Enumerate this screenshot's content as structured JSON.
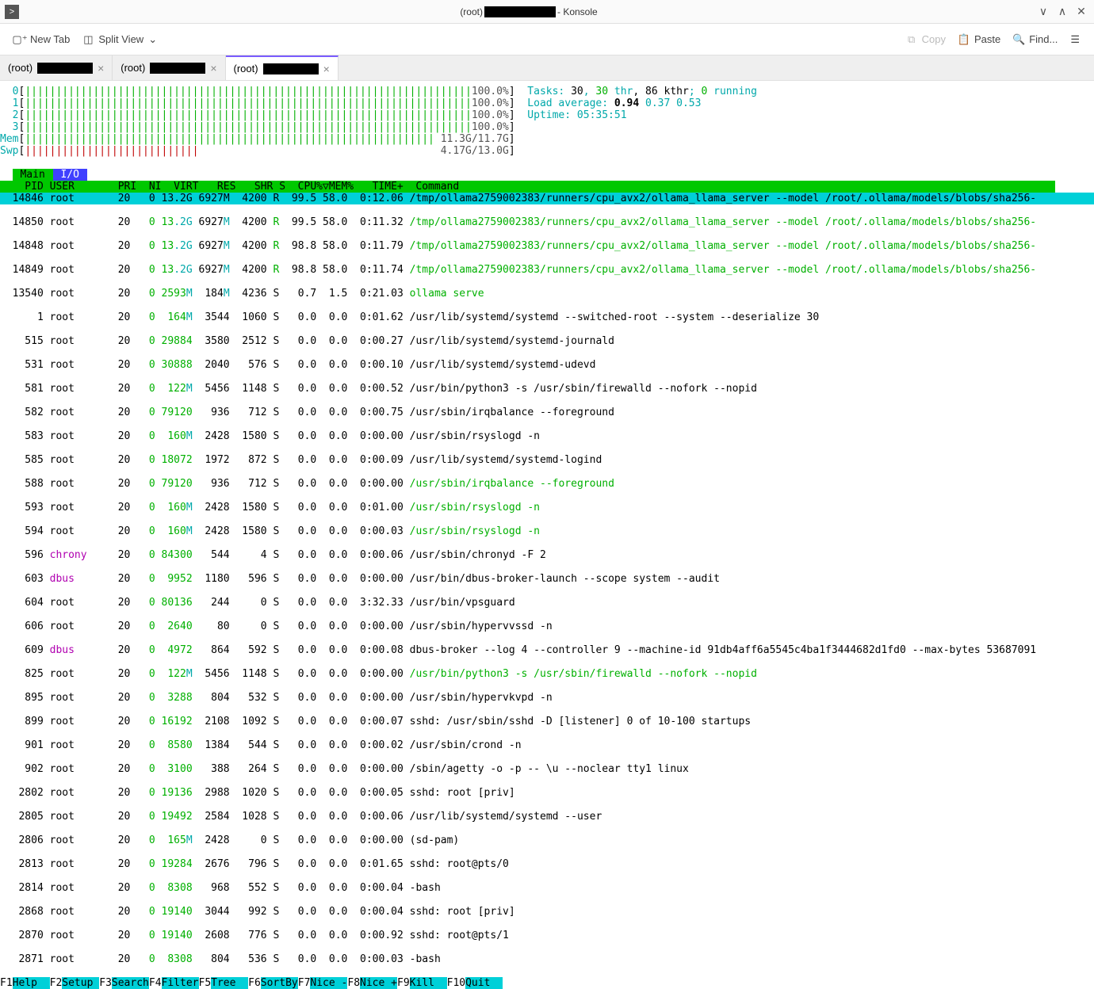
{
  "window": {
    "title_prefix": "(root) ",
    "title_suffix": "- Konsole"
  },
  "toolbar": {
    "new_tab": "New Tab",
    "split_view": "Split View",
    "copy": "Copy",
    "paste": "Paste",
    "find": "Find..."
  },
  "tabs": [
    {
      "label_prefix": "(root)",
      "active": false
    },
    {
      "label_prefix": "(root)",
      "active": false
    },
    {
      "label_prefix": "(root)",
      "active": true
    }
  ],
  "htop": {
    "cpus": [
      {
        "id": "0",
        "pct": "100.0%"
      },
      {
        "id": "1",
        "pct": "100.0%"
      },
      {
        "id": "2",
        "pct": "100.0%"
      },
      {
        "id": "3",
        "pct": "100.0%"
      }
    ],
    "mem": {
      "label": "Mem",
      "used": "11.3G",
      "total": "11.7G"
    },
    "swp": {
      "label": "Swp",
      "used": "4.17G",
      "total": "13.0G"
    },
    "tasks_label": "Tasks: ",
    "tasks_total": "30",
    "tasks_sep1": ", ",
    "tasks_thr": "30",
    "tasks_thr_label": " thr",
    "tasks_sep2": ", ",
    "tasks_kthr": "86 kthr",
    "tasks_sep3": "; ",
    "tasks_running": "0",
    "tasks_running_label": " running",
    "load_label": "Load average: ",
    "load1": "0.94",
    "load5": "0.37",
    "load15": "0.53",
    "uptime_label": "Uptime: ",
    "uptime": "05:35:51",
    "tab_main": "Main",
    "tab_io": "I/O",
    "columns": "    PID USER       PRI  NI  VIRT   RES   SHR S  CPU%▽MEM%   TIME+  Command",
    "processes": [
      {
        "sel": true,
        "pid": "14846",
        "user": "root",
        "pri": "20",
        "ni": "0",
        "virt": "13.2G",
        "virtc": "cyan",
        "res": "6927M",
        "resc": "cyan",
        "shr": "4200",
        "s": "R",
        "sc": "green",
        "cpu": "99.5",
        "mem": "58.0",
        "time": "0:12.06",
        "cmd": "/tmp/ollama2759002383/runners/cpu_avx2/ollama_llama_server --model /root/.ollama/models/blobs/sha256-",
        "cmdc": "black"
      },
      {
        "pid": "14850",
        "user": "root",
        "pri": "20",
        "ni": "0",
        "virt": "13.2G",
        "virtc": "cyan",
        "res": "6927M",
        "resc": "cyan",
        "shr": "4200",
        "s": "R",
        "sc": "green",
        "cpu": "99.5",
        "mem": "58.0",
        "time": "0:11.32",
        "cmd": "/tmp/ollama2759002383/runners/cpu_avx2/ollama_llama_server --model /root/.ollama/models/blobs/sha256-",
        "cmdc": "green"
      },
      {
        "pid": "14848",
        "user": "root",
        "pri": "20",
        "ni": "0",
        "virt": "13.2G",
        "virtc": "cyan",
        "res": "6927M",
        "resc": "cyan",
        "shr": "4200",
        "s": "R",
        "sc": "green",
        "cpu": "98.8",
        "mem": "58.0",
        "time": "0:11.79",
        "cmd": "/tmp/ollama2759002383/runners/cpu_avx2/ollama_llama_server --model /root/.ollama/models/blobs/sha256-",
        "cmdc": "green"
      },
      {
        "pid": "14849",
        "user": "root",
        "pri": "20",
        "ni": "0",
        "virt": "13.2G",
        "virtc": "cyan",
        "res": "6927M",
        "resc": "cyan",
        "shr": "4200",
        "s": "R",
        "sc": "green",
        "cpu": "98.8",
        "mem": "58.0",
        "time": "0:11.74",
        "cmd": "/tmp/ollama2759002383/runners/cpu_avx2/ollama_llama_server --model /root/.ollama/models/blobs/sha256-",
        "cmdc": "green"
      },
      {
        "pid": "13540",
        "user": "root",
        "pri": "20",
        "ni": "0",
        "virt": "2593M",
        "virtc": "cyan",
        "res": "184M",
        "resc": "cyan",
        "shr": "4236",
        "s": "S",
        "sc": "black",
        "cpu": "0.7",
        "mem": "1.5",
        "time": "0:21.03",
        "cmd": "ollama serve",
        "cmdc": "green"
      },
      {
        "pid": "1",
        "user": "root",
        "pri": "20",
        "ni": "0",
        "virt": "164M",
        "virtc": "cyan",
        "res": "3544",
        "resc": "black",
        "shr": "1060",
        "s": "S",
        "sc": "black",
        "cpu": "0.0",
        "mem": "0.0",
        "time": "0:01.62",
        "cmd": "/usr/lib/systemd/systemd --switched-root --system --deserialize 30",
        "cmdc": "black"
      },
      {
        "pid": "515",
        "user": "root",
        "pri": "20",
        "ni": "0",
        "virt": "29884",
        "virtc": "black",
        "res": "3580",
        "resc": "black",
        "shr": "2512",
        "s": "S",
        "sc": "black",
        "cpu": "0.0",
        "mem": "0.0",
        "time": "0:00.27",
        "cmd": "/usr/lib/systemd/systemd-journald",
        "cmdc": "black"
      },
      {
        "pid": "531",
        "user": "root",
        "pri": "20",
        "ni": "0",
        "virt": "30888",
        "virtc": "black",
        "res": "2040",
        "resc": "black",
        "shr": "576",
        "s": "S",
        "sc": "black",
        "cpu": "0.0",
        "mem": "0.0",
        "time": "0:00.10",
        "cmd": "/usr/lib/systemd/systemd-udevd",
        "cmdc": "black"
      },
      {
        "pid": "581",
        "user": "root",
        "pri": "20",
        "ni": "0",
        "virt": "122M",
        "virtc": "cyan",
        "res": "5456",
        "resc": "black",
        "shr": "1148",
        "s": "S",
        "sc": "black",
        "cpu": "0.0",
        "mem": "0.0",
        "time": "0:00.52",
        "cmd": "/usr/bin/python3 -s /usr/sbin/firewalld --nofork --nopid",
        "cmdc": "black"
      },
      {
        "pid": "582",
        "user": "root",
        "pri": "20",
        "ni": "0",
        "virt": "79120",
        "virtc": "black",
        "res": "936",
        "resc": "black",
        "shr": "712",
        "s": "S",
        "sc": "black",
        "cpu": "0.0",
        "mem": "0.0",
        "time": "0:00.75",
        "cmd": "/usr/sbin/irqbalance --foreground",
        "cmdc": "black"
      },
      {
        "pid": "583",
        "user": "root",
        "pri": "20",
        "ni": "0",
        "virt": "160M",
        "virtc": "cyan",
        "res": "2428",
        "resc": "black",
        "shr": "1580",
        "s": "S",
        "sc": "black",
        "cpu": "0.0",
        "mem": "0.0",
        "time": "0:00.00",
        "cmd": "/usr/sbin/rsyslogd -n",
        "cmdc": "black"
      },
      {
        "pid": "585",
        "user": "root",
        "pri": "20",
        "ni": "0",
        "virt": "18072",
        "virtc": "black",
        "res": "1972",
        "resc": "black",
        "shr": "872",
        "s": "S",
        "sc": "black",
        "cpu": "0.0",
        "mem": "0.0",
        "time": "0:00.09",
        "cmd": "/usr/lib/systemd/systemd-logind",
        "cmdc": "black"
      },
      {
        "pid": "588",
        "user": "root",
        "pri": "20",
        "ni": "0",
        "virt": "79120",
        "virtc": "black",
        "res": "936",
        "resc": "black",
        "shr": "712",
        "s": "S",
        "sc": "black",
        "cpu": "0.0",
        "mem": "0.0",
        "time": "0:00.00",
        "cmd": "/usr/sbin/irqbalance --foreground",
        "cmdc": "green"
      },
      {
        "pid": "593",
        "user": "root",
        "pri": "20",
        "ni": "0",
        "virt": "160M",
        "virtc": "cyan",
        "res": "2428",
        "resc": "black",
        "shr": "1580",
        "s": "S",
        "sc": "black",
        "cpu": "0.0",
        "mem": "0.0",
        "time": "0:01.00",
        "cmd": "/usr/sbin/rsyslogd -n",
        "cmdc": "green"
      },
      {
        "pid": "594",
        "user": "root",
        "pri": "20",
        "ni": "0",
        "virt": "160M",
        "virtc": "cyan",
        "res": "2428",
        "resc": "black",
        "shr": "1580",
        "s": "S",
        "sc": "black",
        "cpu": "0.0",
        "mem": "0.0",
        "time": "0:00.03",
        "cmd": "/usr/sbin/rsyslogd -n",
        "cmdc": "green"
      },
      {
        "pid": "596",
        "user": "chrony",
        "userc": "magenta",
        "pri": "20",
        "ni": "0",
        "virt": "84300",
        "virtc": "black",
        "res": "544",
        "resc": "black",
        "shr": "4",
        "s": "S",
        "sc": "black",
        "cpu": "0.0",
        "mem": "0.0",
        "time": "0:00.06",
        "cmd": "/usr/sbin/chronyd -F 2",
        "cmdc": "black"
      },
      {
        "pid": "603",
        "user": "dbus",
        "userc": "magenta",
        "pri": "20",
        "ni": "0",
        "virt": "9952",
        "virtc": "black",
        "res": "1180",
        "resc": "black",
        "shr": "596",
        "s": "S",
        "sc": "black",
        "cpu": "0.0",
        "mem": "0.0",
        "time": "0:00.00",
        "cmd": "/usr/bin/dbus-broker-launch --scope system --audit",
        "cmdc": "black"
      },
      {
        "pid": "604",
        "user": "root",
        "pri": "20",
        "ni": "0",
        "virt": "80136",
        "virtc": "black",
        "res": "244",
        "resc": "black",
        "shr": "0",
        "s": "S",
        "sc": "black",
        "cpu": "0.0",
        "mem": "0.0",
        "time": "3:32.33",
        "cmd": "/usr/bin/vpsguard",
        "cmdc": "black"
      },
      {
        "pid": "606",
        "user": "root",
        "pri": "20",
        "ni": "0",
        "virt": "2640",
        "virtc": "black",
        "res": "80",
        "resc": "black",
        "shr": "0",
        "s": "S",
        "sc": "black",
        "cpu": "0.0",
        "mem": "0.0",
        "time": "0:00.00",
        "cmd": "/usr/sbin/hypervvssd -n",
        "cmdc": "black"
      },
      {
        "pid": "609",
        "user": "dbus",
        "userc": "magenta",
        "pri": "20",
        "ni": "0",
        "virt": "4972",
        "virtc": "black",
        "res": "864",
        "resc": "black",
        "shr": "592",
        "s": "S",
        "sc": "black",
        "cpu": "0.0",
        "mem": "0.0",
        "time": "0:00.08",
        "cmd": "dbus-broker --log 4 --controller 9 --machine-id 91db4aff6a5545c4ba1f3444682d1fd0 --max-bytes 53687091",
        "cmdc": "black"
      },
      {
        "pid": "825",
        "user": "root",
        "pri": "20",
        "ni": "0",
        "virt": "122M",
        "virtc": "cyan",
        "res": "5456",
        "resc": "black",
        "shr": "1148",
        "s": "S",
        "sc": "black",
        "cpu": "0.0",
        "mem": "0.0",
        "time": "0:00.00",
        "cmd": "/usr/bin/python3 -s /usr/sbin/firewalld --nofork --nopid",
        "cmdc": "green"
      },
      {
        "pid": "895",
        "user": "root",
        "pri": "20",
        "ni": "0",
        "virt": "3288",
        "virtc": "black",
        "res": "804",
        "resc": "black",
        "shr": "532",
        "s": "S",
        "sc": "black",
        "cpu": "0.0",
        "mem": "0.0",
        "time": "0:00.00",
        "cmd": "/usr/sbin/hypervkvpd -n",
        "cmdc": "black"
      },
      {
        "pid": "899",
        "user": "root",
        "pri": "20",
        "ni": "0",
        "virt": "16192",
        "virtc": "black",
        "res": "2108",
        "resc": "black",
        "shr": "1092",
        "s": "S",
        "sc": "black",
        "cpu": "0.0",
        "mem": "0.0",
        "time": "0:00.07",
        "cmd": "sshd: /usr/sbin/sshd -D [listener] 0 of 10-100 startups",
        "cmdc": "black"
      },
      {
        "pid": "901",
        "user": "root",
        "pri": "20",
        "ni": "0",
        "virt": "8580",
        "virtc": "black",
        "res": "1384",
        "resc": "black",
        "shr": "544",
        "s": "S",
        "sc": "black",
        "cpu": "0.0",
        "mem": "0.0",
        "time": "0:00.02",
        "cmd": "/usr/sbin/crond -n",
        "cmdc": "black"
      },
      {
        "pid": "902",
        "user": "root",
        "pri": "20",
        "ni": "0",
        "virt": "3100",
        "virtc": "black",
        "res": "388",
        "resc": "black",
        "shr": "264",
        "s": "S",
        "sc": "black",
        "cpu": "0.0",
        "mem": "0.0",
        "time": "0:00.00",
        "cmd": "/sbin/agetty -o -p -- \\u --noclear tty1 linux",
        "cmdc": "black"
      },
      {
        "pid": "2802",
        "user": "root",
        "pri": "20",
        "ni": "0",
        "virt": "19136",
        "virtc": "black",
        "res": "2988",
        "resc": "black",
        "shr": "1020",
        "s": "S",
        "sc": "black",
        "cpu": "0.0",
        "mem": "0.0",
        "time": "0:00.05",
        "cmd": "sshd: root [priv]",
        "cmdc": "black"
      },
      {
        "pid": "2805",
        "user": "root",
        "pri": "20",
        "ni": "0",
        "virt": "19492",
        "virtc": "black",
        "res": "2584",
        "resc": "black",
        "shr": "1028",
        "s": "S",
        "sc": "black",
        "cpu": "0.0",
        "mem": "0.0",
        "time": "0:00.06",
        "cmd": "/usr/lib/systemd/systemd --user",
        "cmdc": "black"
      },
      {
        "pid": "2806",
        "user": "root",
        "pri": "20",
        "ni": "0",
        "virt": "165M",
        "virtc": "cyan",
        "res": "2428",
        "resc": "black",
        "shr": "0",
        "s": "S",
        "sc": "black",
        "cpu": "0.0",
        "mem": "0.0",
        "time": "0:00.00",
        "cmd": "(sd-pam)",
        "cmdc": "black"
      },
      {
        "pid": "2813",
        "user": "root",
        "pri": "20",
        "ni": "0",
        "virt": "19284",
        "virtc": "black",
        "res": "2676",
        "resc": "black",
        "shr": "796",
        "s": "S",
        "sc": "black",
        "cpu": "0.0",
        "mem": "0.0",
        "time": "0:01.65",
        "cmd": "sshd: root@pts/0",
        "cmdc": "black"
      },
      {
        "pid": "2814",
        "user": "root",
        "pri": "20",
        "ni": "0",
        "virt": "8308",
        "virtc": "black",
        "res": "968",
        "resc": "black",
        "shr": "552",
        "s": "S",
        "sc": "black",
        "cpu": "0.0",
        "mem": "0.0",
        "time": "0:00.04",
        "cmd": "-bash",
        "cmdc": "black"
      },
      {
        "pid": "2868",
        "user": "root",
        "pri": "20",
        "ni": "0",
        "virt": "19140",
        "virtc": "black",
        "res": "3044",
        "resc": "black",
        "shr": "992",
        "s": "S",
        "sc": "black",
        "cpu": "0.0",
        "mem": "0.0",
        "time": "0:00.04",
        "cmd": "sshd: root [priv]",
        "cmdc": "black"
      },
      {
        "pid": "2870",
        "user": "root",
        "pri": "20",
        "ni": "0",
        "virt": "19140",
        "virtc": "black",
        "res": "2608",
        "resc": "black",
        "shr": "776",
        "s": "S",
        "sc": "black",
        "cpu": "0.0",
        "mem": "0.0",
        "time": "0:00.92",
        "cmd": "sshd: root@pts/1",
        "cmdc": "black"
      },
      {
        "pid": "2871",
        "user": "root",
        "pri": "20",
        "ni": "0",
        "virt": "8308",
        "virtc": "black",
        "res": "804",
        "resc": "black",
        "shr": "536",
        "s": "S",
        "sc": "black",
        "cpu": "0.0",
        "mem": "0.0",
        "time": "0:00.03",
        "cmd": "-bash",
        "cmdc": "black"
      }
    ],
    "footer": [
      {
        "k": "F1",
        "l": "Help  "
      },
      {
        "k": "F2",
        "l": "Setup "
      },
      {
        "k": "F3",
        "l": "Search"
      },
      {
        "k": "F4",
        "l": "Filter"
      },
      {
        "k": "F5",
        "l": "Tree  "
      },
      {
        "k": "F6",
        "l": "SortBy"
      },
      {
        "k": "F7",
        "l": "Nice -"
      },
      {
        "k": "F8",
        "l": "Nice +"
      },
      {
        "k": "F9",
        "l": "Kill  "
      },
      {
        "k": "F10",
        "l": "Quit  "
      }
    ]
  }
}
